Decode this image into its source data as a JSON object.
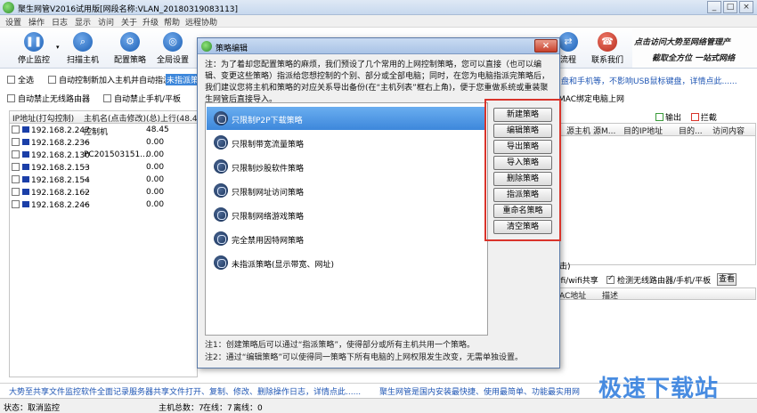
{
  "window": {
    "title": "聚生网管V2016试用版[网段名称:VLAN_20180319083113]",
    "controls": [
      "_",
      "□",
      "×"
    ]
  },
  "menu": [
    "设置",
    "操作",
    "日志",
    "显示",
    "访问",
    "关于",
    "升级",
    "帮助",
    "远程协助"
  ],
  "toolbar": {
    "items": [
      {
        "label": "停止监控",
        "icon": "pause-icon",
        "glyph": "❚❚"
      },
      {
        "label": "扫描主机",
        "icon": "scan-icon",
        "glyph": "⌕"
      },
      {
        "label": "配置策略",
        "icon": "config-icon",
        "glyph": "⚙"
      },
      {
        "label": "全局设置",
        "icon": "global-icon",
        "glyph": "◎"
      },
      {
        "label": "流程",
        "icon": "flow-icon",
        "glyph": "⇄"
      },
      {
        "label": "联系我们",
        "icon": "phone-icon",
        "glyph": "☎"
      }
    ],
    "banner_line1": "点击访问大势至网络管理产",
    "banner_line2": "截取全方位 一站式网络"
  },
  "options": {
    "row1": [
      "全选",
      "自动控制新加入主机并自动指派",
      "未指派策略"
    ],
    "row2": [
      "自动禁止无线路由器",
      "自动禁止手机/平板"
    ]
  },
  "hosts": {
    "headers": [
      "IP地址(打勾控制)",
      "主机名(点击修改)",
      "(总)上行(48.45 K"
    ],
    "rows": [
      {
        "ip": "192.168.2.247",
        "name": "控制机",
        "up": "48.45"
      },
      {
        "ip": "192.168.2.236",
        "name": "--",
        "up": "0.00"
      },
      {
        "ip": "192.168.2.130",
        "name": "PC201503151...",
        "up": "0.00"
      },
      {
        "ip": "192.168.2.153",
        "name": "--",
        "up": "0.00"
      },
      {
        "ip": "192.168.2.154",
        "name": "--",
        "up": "0.00"
      },
      {
        "ip": "192.168.2.162",
        "name": "--",
        "up": "0.00"
      },
      {
        "ip": "192.168.2.246",
        "name": "--",
        "up": "0.00"
      }
    ]
  },
  "right": {
    "title": "MAC绑定电脑上网",
    "notice": "盘和手机等，不影响USB鼠标键盘，详情点此......",
    "legend": {
      "output": "输出",
      "block": "拦截",
      "output_color": "#3a9a3a",
      "block_color": "#d9342b"
    },
    "headers": [
      "源主机",
      "源M...",
      "目的IP地址",
      "目的...",
      "访问内容"
    ],
    "low_opts": [
      "ifi/wifi共享",
      "检测无线路由器/手机/平板"
    ],
    "low_view_btn": "查看",
    "low_headers": [
      "AC地址",
      "描述"
    ],
    "scroll_tail": "击)"
  },
  "bottom": {
    "ad_left": "大势至共享文件监控软件全面记录服务器共享文件打开、复制、修改、删除操作日志，详情点此......",
    "ad_right": "聚生网管是国内安装最快捷、使用最简单、功能最实用网",
    "status_label": "状态：取消监控",
    "hosts_total": "主机总数：7",
    "online": "在线：7",
    "offline": "离线：0",
    "watermark": "极速下载站"
  },
  "dialog": {
    "title": "策略编辑",
    "close": "×",
    "note": "注：为了着却您配置策略的麻烦，我们预设了几个常用的上网控制策略，您可以直接（也可以编辑、变更这些策略）指派给您想控制的个别、部分或全部电脑；同时，在您为电脑指派完策略后，我们建议您将主机和策略的对应关系导出备份(在“主机列表”框右上角)，便于您重做系统或重装聚生网管后直接导入。",
    "policies": [
      {
        "label": "只限制P2P下载策略",
        "selected": true
      },
      {
        "label": "只限制带宽流量策略",
        "selected": false
      },
      {
        "label": "只限制炒股软件策略",
        "selected": false
      },
      {
        "label": "只限制网址访问策略",
        "selected": false
      },
      {
        "label": "只限制网络游戏策略",
        "selected": false
      },
      {
        "label": "完全禁用因特网策略",
        "selected": false
      },
      {
        "label": "未指派策略(显示带宽、网址)",
        "selected": false
      }
    ],
    "buttons": [
      "新建策略",
      "编辑策略",
      "导出策略",
      "导入策略",
      "删除策略",
      "指派策略",
      "重命名策略",
      "清空策略"
    ],
    "foot1": "注1：创建策略后可以通过“指派策略”，使得部分或所有主机共用一个策略。",
    "foot2": "注2：通过“编辑策略”可以使得同一策略下所有电脑的上网权限发生改变，无需单独设置。"
  }
}
